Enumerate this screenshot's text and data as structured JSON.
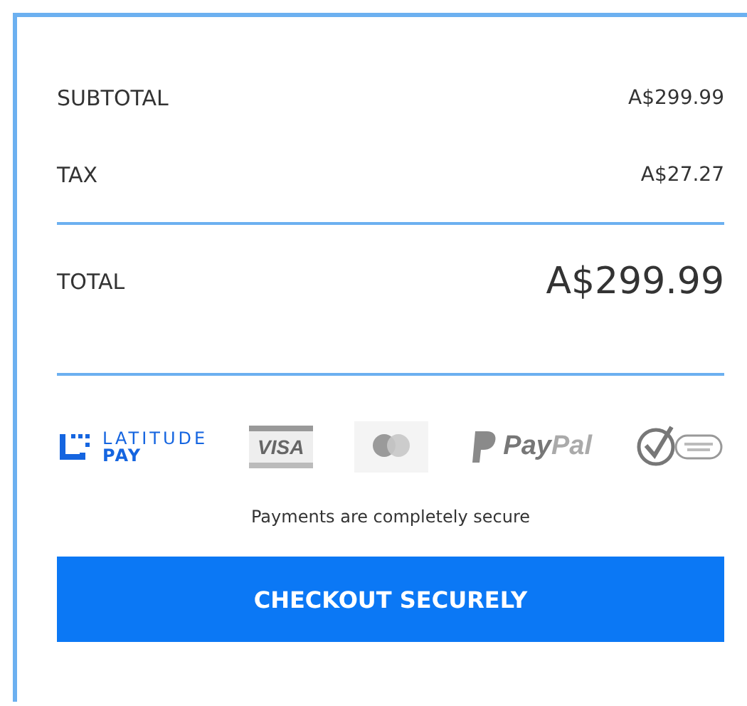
{
  "summary": [
    {
      "label": "SUBTOTAL",
      "value": "A$299.99"
    },
    {
      "label": "TAX",
      "value": "A$27.27"
    }
  ],
  "total": {
    "label": "TOTAL",
    "value": "A$299.99"
  },
  "payment_methods": [
    {
      "kind": "latitude",
      "label": "LATITUDE",
      "sublabel": "PAY"
    },
    {
      "kind": "visa",
      "label": "VISA"
    },
    {
      "kind": "mastercard"
    },
    {
      "kind": "paypal",
      "label": "Pay",
      "label2": "Pal"
    },
    {
      "kind": "verisign"
    }
  ],
  "secure_note": "Payments are completely secure",
  "checkout_button": "CHECKOUT SECURELY"
}
